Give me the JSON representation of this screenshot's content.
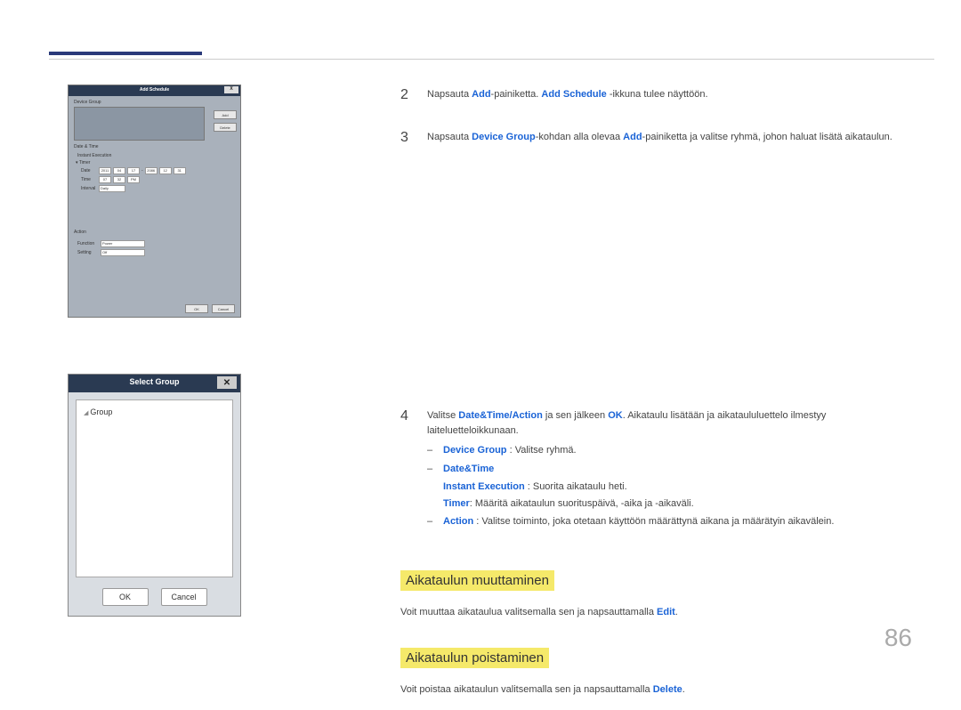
{
  "page_number": "86",
  "shot1": {
    "title": "Add Schedule",
    "close": "X",
    "device_group_label": "Device Group",
    "add_btn": "Add",
    "delete_btn": "Delete",
    "date_time_label": "Date & Time",
    "instant_execution": "Instant Execution",
    "timer_label": "Timer",
    "date_label": "Date",
    "date_vals": {
      "y1": "2011",
      "m1": "04",
      "d1": "17",
      "sep": "-",
      "y2": "2086",
      "m2": "12",
      "d2": "31"
    },
    "time_label": "Time",
    "time_vals": {
      "h": "07",
      "m": "32",
      "ampm": "PM"
    },
    "interval_label": "Interval",
    "interval_val": "Daily",
    "action_label": "Action",
    "function_label": "Function",
    "function_val": "Power",
    "setting_label": "Setting",
    "setting_val": "Off",
    "ok": "OK",
    "cancel": "Cancel"
  },
  "shot2": {
    "title": "Select Group",
    "close": "✕",
    "group": "Group",
    "ok": "OK",
    "cancel": "Cancel"
  },
  "steps": {
    "s2": {
      "num": "2",
      "pre": "Napsauta ",
      "add": "Add",
      "mid": "-painiketta. ",
      "add_schedule": "Add Schedule ",
      "post": "-ikkuna tulee näyttöön."
    },
    "s3": {
      "num": "3",
      "pre": "Napsauta ",
      "dg": "Device Group",
      "mid": "-kohdan alla olevaa ",
      "add": "Add",
      "post": "-painiketta ja valitse ryhmä, johon haluat lisätä aikataulun."
    },
    "s4": {
      "num": "4",
      "pre": "Valitse ",
      "dta": "Date&Time/Action",
      "mid": " ja sen jälkeen ",
      "ok": "OK",
      "post": ". Aikataulu lisätään ja aikataululuettelo ilmestyy laiteluetteloikkunaan.",
      "items": {
        "dg_label": "Device Group",
        "dg_text": " : Valitse ryhmä.",
        "dt_label": "Date&Time",
        "ie_label": "Instant Execution",
        "ie_text": " : Suorita aikataulu heti.",
        "timer_label": "Timer",
        "timer_text": ": Määritä aikataulun suorituspäivä, -aika ja -aikaväli.",
        "action_label": "Action",
        "action_text": " : Valitse toiminto, joka otetaan käyttöön määrättynä aikana ja määrätyin aikavälein."
      }
    }
  },
  "mod_heading": "Aikataulun muuttaminen",
  "mod_text_pre": "Voit muuttaa aikataulua valitsemalla sen ja napsauttamalla ",
  "mod_edit": "Edit",
  "mod_text_post": ".",
  "del_heading": "Aikataulun poistaminen",
  "del_text_pre": "Voit poistaa aikataulun valitsemalla sen ja napsauttamalla ",
  "del_delete": "Delete",
  "del_text_post": "."
}
